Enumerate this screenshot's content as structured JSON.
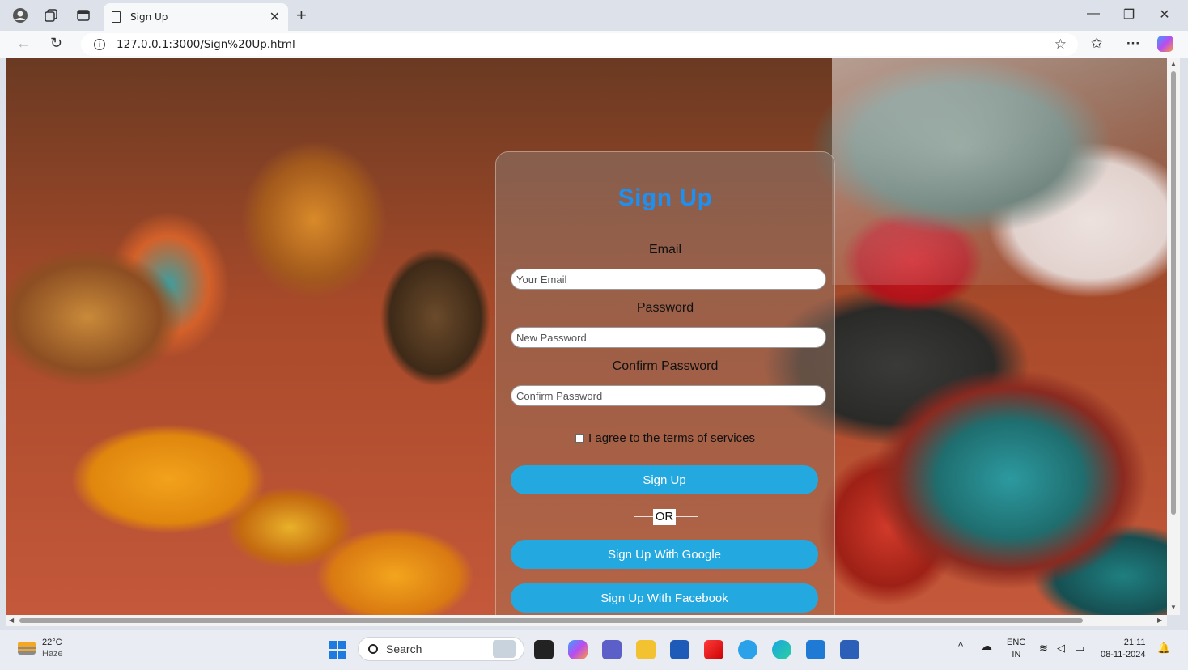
{
  "browser": {
    "tab_title": "Sign Up",
    "new_tab_label": "+",
    "url": "127.0.0.1:3000/Sign%20Up.html"
  },
  "signup": {
    "title": "Sign Up",
    "email_label": "Email",
    "email_placeholder": "Your Email",
    "password_label": "Password",
    "password_placeholder": "New Password",
    "confirm_label": "Confirm Password",
    "confirm_placeholder": "Confirm Password",
    "agree_text": "I agree to the terms of services",
    "signup_button": "Sign Up",
    "or_text": "OR",
    "google_button": "Sign Up With Google",
    "facebook_button": "Sign Up With Facebook"
  },
  "taskbar": {
    "temperature": "22°C",
    "weather": "Haze",
    "search_label": "Search",
    "lang_line1": "ENG",
    "lang_line2": "IN",
    "time": "21:11",
    "date": "08-11-2024"
  },
  "colors": {
    "accent": "#23a9e0",
    "title": "#1f8ff0"
  }
}
